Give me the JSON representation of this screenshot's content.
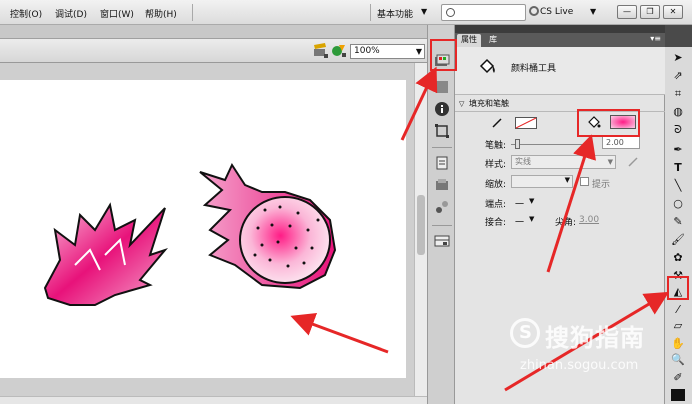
{
  "menubar": {
    "items": [
      "控制(O)",
      "调试(D)",
      "窗口(W)",
      "帮助(H)"
    ],
    "workspace": "基本功能",
    "cslive": "CS Live"
  },
  "stage": {
    "zoom": "100%"
  },
  "panel": {
    "tabs": [
      "属性",
      "库"
    ],
    "tool_title": "颜料桶工具",
    "section_fill_stroke": "填充和笔触",
    "stroke_label": "笔触:",
    "stroke_value": "2.00",
    "style_label": "样式:",
    "style_value": "实线",
    "scale_label": "缩放:",
    "hint_label": "提示",
    "cap_label": "端点:",
    "cap_value": "一",
    "join_label": "接合:",
    "join_value": "一",
    "miter_label": "尖角:",
    "miter_value": "3.00"
  },
  "colors": {
    "accent_red": "#e62727",
    "fill_pink": "#e8127a",
    "pitaya_light": "#f7a6cf"
  },
  "watermark": {
    "logo_letter": "S",
    "text": "搜狗指南",
    "url": "zhinan.sogou.com"
  }
}
